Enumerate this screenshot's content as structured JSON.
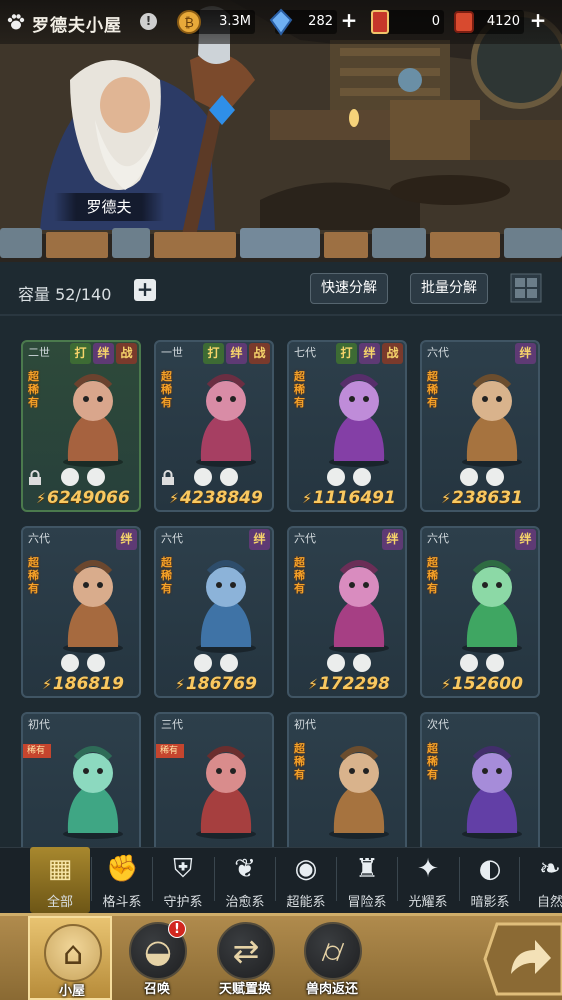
{
  "header": {
    "title": "罗德夫小屋",
    "info_icon": "!",
    "resources": [
      {
        "name": "coin",
        "value": "3.3M"
      },
      {
        "name": "crystal",
        "value": "282"
      },
      {
        "name": "card-ticket",
        "value": "0"
      },
      {
        "name": "red-ticket",
        "value": "4120"
      }
    ]
  },
  "npc": {
    "name": "罗德夫"
  },
  "toolbar": {
    "capacity": "容量 52/140",
    "quick_decompose": "快速分解",
    "batch_decompose": "批量分解"
  },
  "cards": [
    {
      "gen": "二世",
      "tags": [
        "打",
        "绊",
        "战"
      ],
      "rarity": "超稀有",
      "power": "6249066",
      "locked": true,
      "elements": [
        "fighting-icon",
        "fire-icon"
      ],
      "frame": "green"
    },
    {
      "gen": "一世",
      "tags": [
        "打",
        "绊",
        "战"
      ],
      "rarity": "超稀有",
      "power": "4238849",
      "locked": true,
      "elements": [
        "flame-icon",
        "water-icon"
      ],
      "frame": "blue"
    },
    {
      "gen": "七代",
      "tags": [
        "打",
        "绊",
        "战"
      ],
      "rarity": "超稀有",
      "power": "1116491",
      "locked": false,
      "elements": [
        "leaf-icon",
        "water-icon"
      ],
      "frame": "blue"
    },
    {
      "gen": "六代",
      "tags": [
        "绊"
      ],
      "rarity": "超稀有",
      "power": "238631",
      "locked": false,
      "elements": [
        "shell-icon",
        "earth-icon"
      ],
      "frame": "blue"
    },
    {
      "gen": "六代",
      "tags": [
        "绊"
      ],
      "rarity": "超稀有",
      "power": "186819",
      "locked": false,
      "elements": [
        "light-icon",
        "sun-icon"
      ],
      "frame": "blue"
    },
    {
      "gen": "六代",
      "tags": [
        "绊"
      ],
      "rarity": "超稀有",
      "power": "186769",
      "locked": false,
      "elements": [
        "shadow-icon",
        "moon-icon"
      ],
      "frame": "blue"
    },
    {
      "gen": "六代",
      "tags": [
        "绊"
      ],
      "rarity": "超稀有",
      "power": "172298",
      "locked": false,
      "elements": [
        "leaf-icon",
        "water-icon"
      ],
      "frame": "blue"
    },
    {
      "gen": "六代",
      "tags": [
        "绊"
      ],
      "rarity": "超稀有",
      "power": "152600",
      "locked": false,
      "elements": [
        "leaf-icon",
        "earth-icon"
      ],
      "frame": "blue"
    },
    {
      "gen": "初代",
      "tags": [],
      "rarity": "",
      "power": "",
      "locked": false,
      "elements": [],
      "frame": "blue",
      "ribbon": "稀有"
    },
    {
      "gen": "三代",
      "tags": [],
      "rarity": "",
      "power": "",
      "locked": false,
      "elements": [],
      "frame": "blue",
      "ribbon": "稀有"
    },
    {
      "gen": "初代",
      "tags": [],
      "rarity": "超稀有",
      "power": "",
      "locked": false,
      "elements": [],
      "frame": "blue"
    },
    {
      "gen": "次代",
      "tags": [],
      "rarity": "超稀有",
      "power": "",
      "locked": false,
      "elements": [],
      "frame": "blue"
    }
  ],
  "filters": [
    {
      "label": "全部",
      "icon": "all-icon"
    },
    {
      "label": "格斗系",
      "icon": "fist-icon"
    },
    {
      "label": "守护系",
      "icon": "shield-icon"
    },
    {
      "label": "治愈系",
      "icon": "sprout-icon"
    },
    {
      "label": "超能系",
      "icon": "psychic-icon"
    },
    {
      "label": "冒险系",
      "icon": "tower-icon"
    },
    {
      "label": "光耀系",
      "icon": "star-icon"
    },
    {
      "label": "暗影系",
      "icon": "eye-icon"
    },
    {
      "label": "自然",
      "icon": "leaf-icon"
    }
  ],
  "bottom_nav": [
    {
      "label": "小屋",
      "icon": "house-icon"
    },
    {
      "label": "召唤",
      "icon": "egg-icon",
      "badge": "!"
    },
    {
      "label": "天赋置换",
      "icon": "swap-icon"
    },
    {
      "label": "兽肉返还",
      "icon": "meat-icon"
    }
  ],
  "colors": {
    "accent_gold": "#f8c861",
    "rare_orange": "#f4a128",
    "panel": "#1e2a31"
  }
}
